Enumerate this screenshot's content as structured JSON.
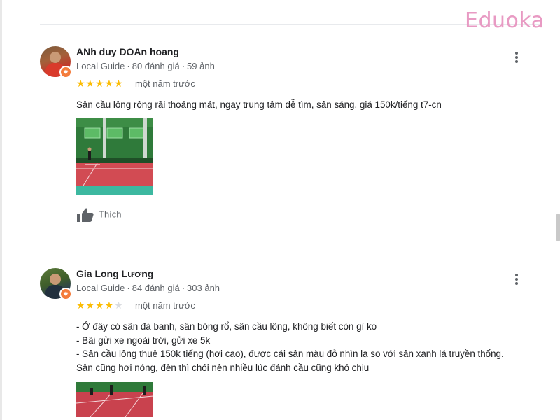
{
  "brand": {
    "logo_text": "Eduoka"
  },
  "reviews": [
    {
      "author": "ANh duy DOAn hoang",
      "guide_label": "Local Guide",
      "review_count": "80 đánh giá",
      "photo_count": "59 ảnh",
      "rating": 5,
      "stars_text": "★★★★★",
      "stars_empty_text": "",
      "time": "một năm trước",
      "text_lines": [
        "Sân cầu lông rộng rãi thoáng mát, ngay trung tâm dễ tìm, sân sáng, giá 150k/tiếng t7-cn"
      ],
      "like_label": "Thích"
    },
    {
      "author": "Gia Long Lương",
      "guide_label": "Local Guide",
      "review_count": "84 đánh giá",
      "photo_count": "303 ảnh",
      "rating": 4,
      "stars_text": "★★★★",
      "stars_empty_text": "★",
      "time": "một năm trước",
      "text_lines": [
        "- Ở đây có sân đá banh, sân bóng rổ, sân cầu lông, không biết còn gì ko",
        "- Bãi gửi xe ngoài trời, gửi xe 5k",
        "- Sân cầu lông thuê 150k tiếng (hơi cao), được cái sân màu đỏ nhìn lạ so với sân xanh lá truyền thống.",
        "Sân cũng hơi nóng, đèn thì chói nên nhiều lúc đánh cầu cũng khó chịu"
      ]
    }
  ],
  "colors": {
    "star": "#fbbc04",
    "brand": "#e89ac3",
    "guide_badge": "#f47c3c"
  },
  "icons": {
    "more": "more-vert-icon",
    "like": "thumbs-up-icon",
    "badge": "local-guide-badge-icon"
  }
}
